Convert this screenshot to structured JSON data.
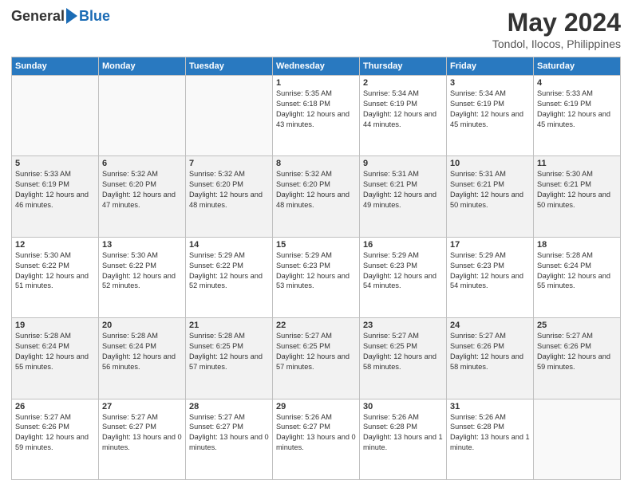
{
  "logo": {
    "general": "General",
    "blue": "Blue"
  },
  "title": "May 2024",
  "subtitle": "Tondol, Ilocos, Philippines",
  "weekdays": [
    "Sunday",
    "Monday",
    "Tuesday",
    "Wednesday",
    "Thursday",
    "Friday",
    "Saturday"
  ],
  "weeks": [
    [
      {
        "day": "",
        "info": ""
      },
      {
        "day": "",
        "info": ""
      },
      {
        "day": "",
        "info": ""
      },
      {
        "day": "1",
        "info": "Sunrise: 5:35 AM\nSunset: 6:18 PM\nDaylight: 12 hours\nand 43 minutes."
      },
      {
        "day": "2",
        "info": "Sunrise: 5:34 AM\nSunset: 6:19 PM\nDaylight: 12 hours\nand 44 minutes."
      },
      {
        "day": "3",
        "info": "Sunrise: 5:34 AM\nSunset: 6:19 PM\nDaylight: 12 hours\nand 45 minutes."
      },
      {
        "day": "4",
        "info": "Sunrise: 5:33 AM\nSunset: 6:19 PM\nDaylight: 12 hours\nand 45 minutes."
      }
    ],
    [
      {
        "day": "5",
        "info": "Sunrise: 5:33 AM\nSunset: 6:19 PM\nDaylight: 12 hours\nand 46 minutes."
      },
      {
        "day": "6",
        "info": "Sunrise: 5:32 AM\nSunset: 6:20 PM\nDaylight: 12 hours\nand 47 minutes."
      },
      {
        "day": "7",
        "info": "Sunrise: 5:32 AM\nSunset: 6:20 PM\nDaylight: 12 hours\nand 48 minutes."
      },
      {
        "day": "8",
        "info": "Sunrise: 5:32 AM\nSunset: 6:20 PM\nDaylight: 12 hours\nand 48 minutes."
      },
      {
        "day": "9",
        "info": "Sunrise: 5:31 AM\nSunset: 6:21 PM\nDaylight: 12 hours\nand 49 minutes."
      },
      {
        "day": "10",
        "info": "Sunrise: 5:31 AM\nSunset: 6:21 PM\nDaylight: 12 hours\nand 50 minutes."
      },
      {
        "day": "11",
        "info": "Sunrise: 5:30 AM\nSunset: 6:21 PM\nDaylight: 12 hours\nand 50 minutes."
      }
    ],
    [
      {
        "day": "12",
        "info": "Sunrise: 5:30 AM\nSunset: 6:22 PM\nDaylight: 12 hours\nand 51 minutes."
      },
      {
        "day": "13",
        "info": "Sunrise: 5:30 AM\nSunset: 6:22 PM\nDaylight: 12 hours\nand 52 minutes."
      },
      {
        "day": "14",
        "info": "Sunrise: 5:29 AM\nSunset: 6:22 PM\nDaylight: 12 hours\nand 52 minutes."
      },
      {
        "day": "15",
        "info": "Sunrise: 5:29 AM\nSunset: 6:23 PM\nDaylight: 12 hours\nand 53 minutes."
      },
      {
        "day": "16",
        "info": "Sunrise: 5:29 AM\nSunset: 6:23 PM\nDaylight: 12 hours\nand 54 minutes."
      },
      {
        "day": "17",
        "info": "Sunrise: 5:29 AM\nSunset: 6:23 PM\nDaylight: 12 hours\nand 54 minutes."
      },
      {
        "day": "18",
        "info": "Sunrise: 5:28 AM\nSunset: 6:24 PM\nDaylight: 12 hours\nand 55 minutes."
      }
    ],
    [
      {
        "day": "19",
        "info": "Sunrise: 5:28 AM\nSunset: 6:24 PM\nDaylight: 12 hours\nand 55 minutes."
      },
      {
        "day": "20",
        "info": "Sunrise: 5:28 AM\nSunset: 6:24 PM\nDaylight: 12 hours\nand 56 minutes."
      },
      {
        "day": "21",
        "info": "Sunrise: 5:28 AM\nSunset: 6:25 PM\nDaylight: 12 hours\nand 57 minutes."
      },
      {
        "day": "22",
        "info": "Sunrise: 5:27 AM\nSunset: 6:25 PM\nDaylight: 12 hours\nand 57 minutes."
      },
      {
        "day": "23",
        "info": "Sunrise: 5:27 AM\nSunset: 6:25 PM\nDaylight: 12 hours\nand 58 minutes."
      },
      {
        "day": "24",
        "info": "Sunrise: 5:27 AM\nSunset: 6:26 PM\nDaylight: 12 hours\nand 58 minutes."
      },
      {
        "day": "25",
        "info": "Sunrise: 5:27 AM\nSunset: 6:26 PM\nDaylight: 12 hours\nand 59 minutes."
      }
    ],
    [
      {
        "day": "26",
        "info": "Sunrise: 5:27 AM\nSunset: 6:26 PM\nDaylight: 12 hours\nand 59 minutes."
      },
      {
        "day": "27",
        "info": "Sunrise: 5:27 AM\nSunset: 6:27 PM\nDaylight: 13 hours\nand 0 minutes."
      },
      {
        "day": "28",
        "info": "Sunrise: 5:27 AM\nSunset: 6:27 PM\nDaylight: 13 hours\nand 0 minutes."
      },
      {
        "day": "29",
        "info": "Sunrise: 5:26 AM\nSunset: 6:27 PM\nDaylight: 13 hours\nand 0 minutes."
      },
      {
        "day": "30",
        "info": "Sunrise: 5:26 AM\nSunset: 6:28 PM\nDaylight: 13 hours\nand 1 minute."
      },
      {
        "day": "31",
        "info": "Sunrise: 5:26 AM\nSunset: 6:28 PM\nDaylight: 13 hours\nand 1 minute."
      },
      {
        "day": "",
        "info": ""
      }
    ]
  ]
}
